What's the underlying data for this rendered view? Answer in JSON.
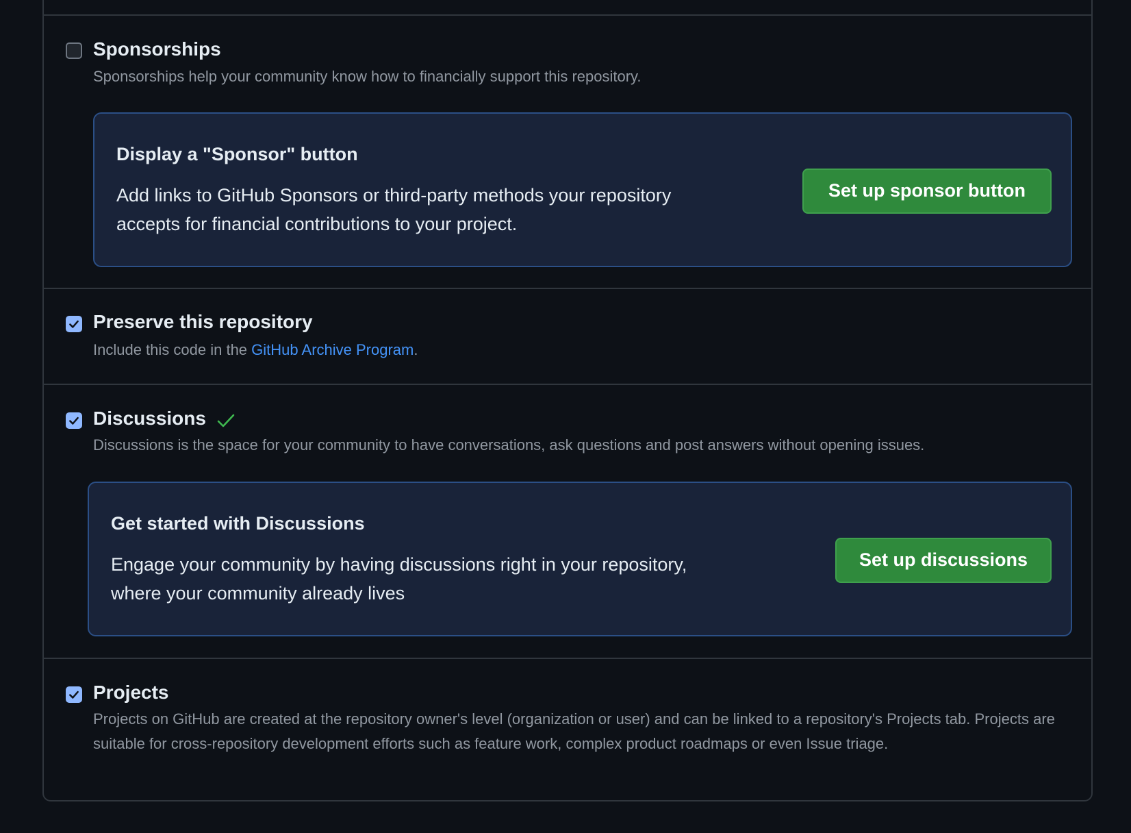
{
  "sponsorships": {
    "title": "Sponsorships",
    "checked": false,
    "description": "Sponsorships help your community know how to financially support this repository.",
    "callout": {
      "title": "Display a \"Sponsor\" button",
      "body": "Add links to GitHub Sponsors or third-party methods your repository accepts for financial contributions to your project.",
      "button_label": "Set up sponsor button"
    }
  },
  "preserve": {
    "title": "Preserve this repository",
    "checked": true,
    "description_prefix": "Include this code in the ",
    "link_text": "GitHub Archive Program",
    "description_suffix": "."
  },
  "discussions": {
    "title": "Discussions",
    "checked": true,
    "status_icon": "check-icon",
    "description": "Discussions is the space for your community to have conversations, ask questions and post answers without opening issues.",
    "callout": {
      "title": "Get started with Discussions",
      "body": "Engage your community by having discussions right in your repository, where your community already lives",
      "button_label": "Set up discussions"
    }
  },
  "projects": {
    "title": "Projects",
    "checked": true,
    "description": "Projects on GitHub are created at the repository owner's level (organization or user) and can be linked to a repository's Projects tab. Projects are suitable for cross-repository development efforts such as feature work, complex product roadmaps or even Issue triage."
  },
  "colors": {
    "background": "#0d1117",
    "border": "#30363d",
    "callout_bg": "#192339",
    "callout_border": "#2b4f86",
    "button_green": "#2f8a3c",
    "checkbox_checked": "#8fb8ff",
    "link": "#4493f8",
    "success_check": "#3fb950"
  }
}
